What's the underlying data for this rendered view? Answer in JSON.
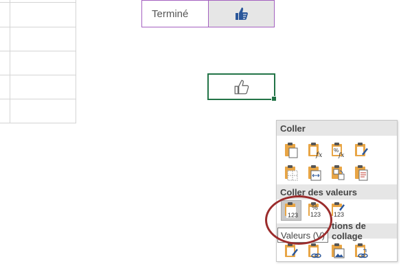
{
  "table": {
    "status_label": "Terminé"
  },
  "menu": {
    "sections": {
      "paste": "Coller",
      "paste_values": "Coller des valeurs",
      "other_options_partial": "tions de collage"
    },
    "paste_icons": [
      "paste-icon",
      "paste-formulas-icon",
      "paste-formulas-number-format-icon",
      "keep-source-formatting-icon",
      "no-borders-icon",
      "keep-column-widths-icon",
      "transpose-icon",
      "paste-link-icon"
    ],
    "value_icons": [
      "values-icon",
      "values-number-format-icon",
      "values-source-formatting-icon"
    ],
    "value_badges": [
      "123",
      "123",
      "123"
    ],
    "value_percent": "%",
    "other_icons": [
      "formatting-icon",
      "paste-link-icon",
      "picture-icon",
      "linked-picture-icon"
    ],
    "tooltip": "Valeurs (V)"
  },
  "colors": {
    "purple_border": "#a35fbf",
    "excel_green": "#217346",
    "highlight_ring": "#9b2c2c",
    "thumb_blue": "#2b579a"
  }
}
